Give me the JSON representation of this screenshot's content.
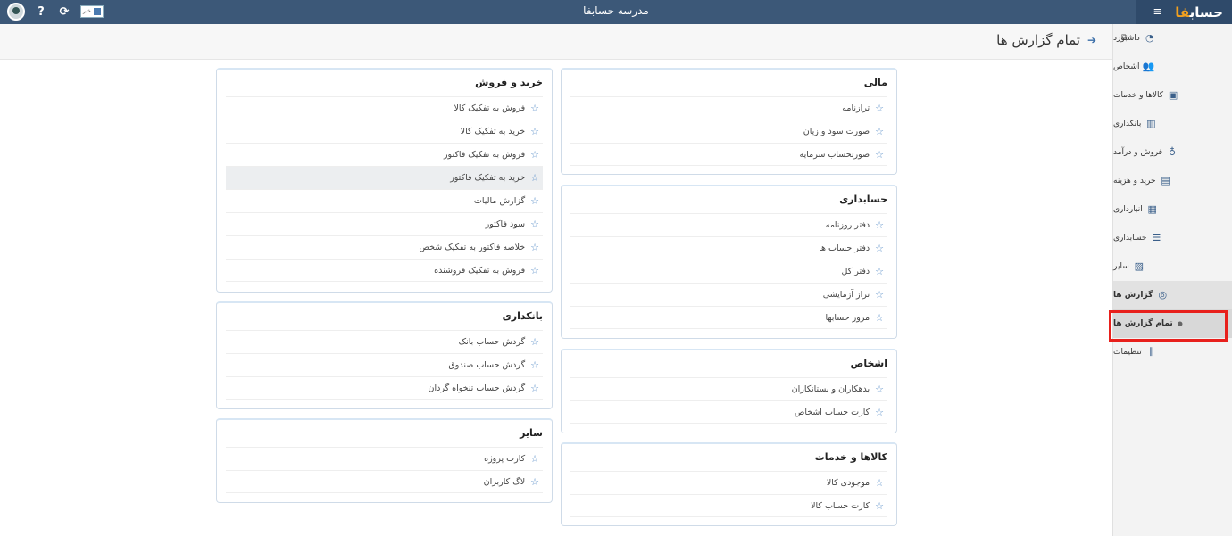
{
  "topbar": {
    "app_title": "مدرسه حسابفا",
    "brand": "حساب",
    "brand_accent": "فا",
    "news_label": "خبر"
  },
  "page": {
    "title": "تمام گزارش ها"
  },
  "sidebar": {
    "items": [
      {
        "label": "داشبورد",
        "icon": "dashboard-icon"
      },
      {
        "label": "اشخاص",
        "icon": "people-icon"
      },
      {
        "label": "کالاها و خدمات",
        "icon": "box-icon"
      },
      {
        "label": "بانکداری",
        "icon": "bank-icon"
      },
      {
        "label": "فروش و درآمد",
        "icon": "sales-icon"
      },
      {
        "label": "خرید و هزینه",
        "icon": "wallet-icon"
      },
      {
        "label": "انبارداری",
        "icon": "warehouse-icon"
      },
      {
        "label": "حسابداری",
        "icon": "ledger-icon"
      },
      {
        "label": "سایر",
        "icon": "other-icon"
      },
      {
        "label": "گزارش ها",
        "icon": "reports-icon"
      },
      {
        "label": "تمام گزارش ها",
        "icon": "dot-icon"
      },
      {
        "label": "تنظیمات",
        "icon": "settings-icon"
      }
    ]
  },
  "cards": {
    "financial": {
      "title": "مالی",
      "items": [
        "ترازنامه",
        "صورت سود و زیان",
        "صورتحساب سرمایه"
      ]
    },
    "accounting": {
      "title": "حسابداری",
      "items": [
        "دفتر روزنامه",
        "دفتر حساب ها",
        "دفتر کل",
        "تراز آزمایشی",
        "مرور حسابها"
      ]
    },
    "persons": {
      "title": "اشخاص",
      "items": [
        "بدهکاران و بستانکاران",
        "کارت حساب اشخاص"
      ]
    },
    "goods": {
      "title": "کالاها و خدمات",
      "items": [
        "موجودی کالا",
        "کارت حساب کالا"
      ]
    },
    "buysell": {
      "title": "خرید و فروش",
      "items": [
        "فروش به تفکیک کالا",
        "خرید به تفکیک کالا",
        "فروش به تفکیک فاکتور",
        "خرید به تفکیک فاکتور",
        "گزارش مالیات",
        "سود فاکتور",
        "خلاصه فاکتور به تفکیک شخص",
        "فروش به تفکیک فروشنده"
      ]
    },
    "banking": {
      "title": "بانکداری",
      "items": [
        "گردش حساب بانک",
        "گردش حساب صندوق",
        "گردش حساب تنخواه گردان"
      ]
    },
    "other": {
      "title": "سایر",
      "items": [
        "کارت پروژه",
        "لاگ کاربران"
      ]
    }
  },
  "colors": {
    "accent": "#3c5878",
    "highlight": "#e8201c",
    "star": "#5b8fc9"
  }
}
